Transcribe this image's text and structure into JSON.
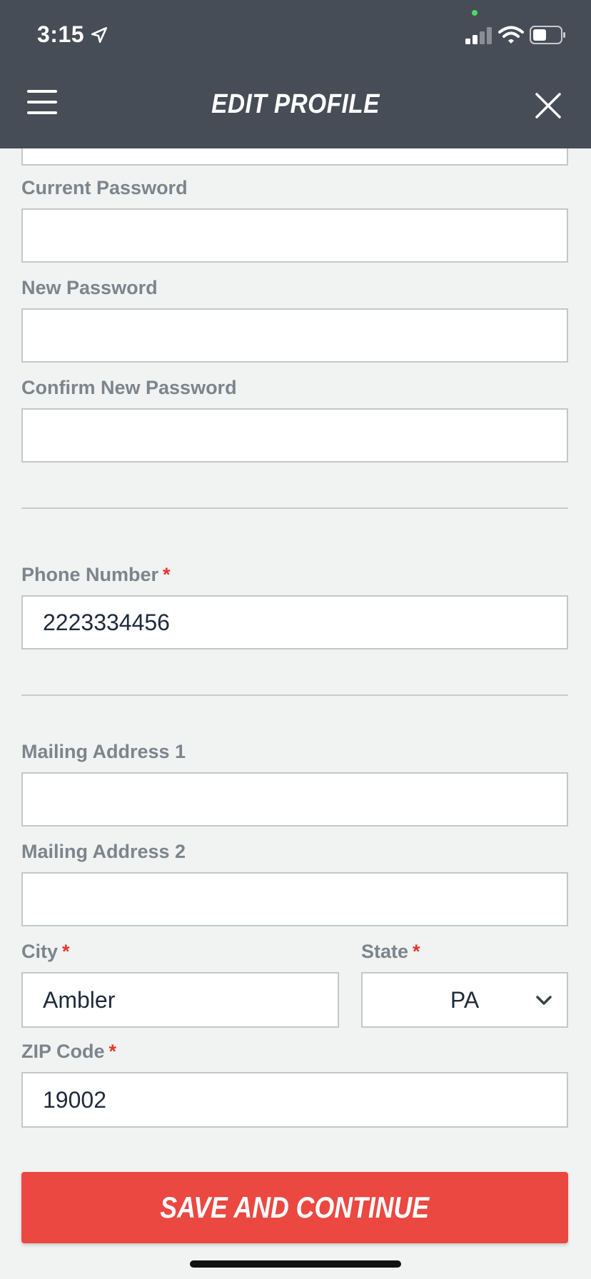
{
  "status_bar": {
    "time": "3:15"
  },
  "header": {
    "title": "EDIT PROFILE"
  },
  "form": {
    "email": {
      "value": ""
    },
    "current_password": {
      "label": "Current Password",
      "value": ""
    },
    "new_password": {
      "label": "New Password",
      "value": ""
    },
    "confirm_password": {
      "label": "Confirm New Password",
      "value": ""
    },
    "phone": {
      "label": "Phone Number",
      "required": "*",
      "value": "2223334456"
    },
    "address1": {
      "label": "Mailing Address 1",
      "value": ""
    },
    "address2": {
      "label": "Mailing Address 2",
      "value": ""
    },
    "city": {
      "label": "City",
      "required": "*",
      "value": "Ambler"
    },
    "state": {
      "label": "State",
      "required": "*",
      "value": "PA"
    },
    "zip": {
      "label": "ZIP Code",
      "required": "*",
      "value": "19002"
    }
  },
  "save_button": {
    "label": "SAVE AND CONTINUE"
  },
  "colors": {
    "header_bg": "#474d56",
    "accent": "#ea4841",
    "required": "#e8342f"
  }
}
